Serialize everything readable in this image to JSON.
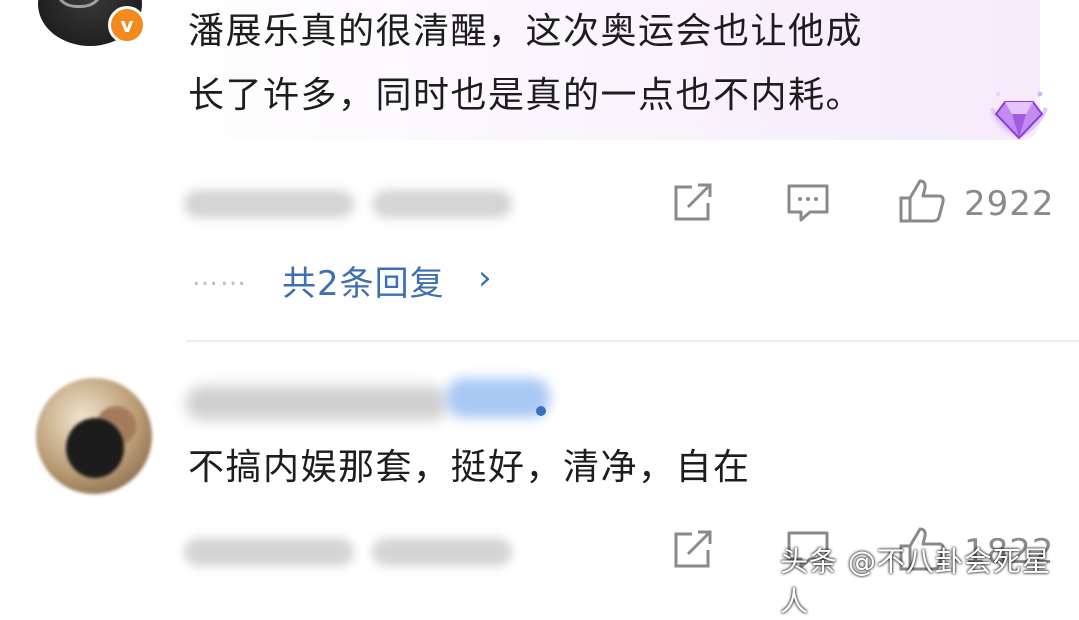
{
  "comments": [
    {
      "verified_badge": "v",
      "text_line1": "潘展乐真的很清醒，这次奥运会也让他成",
      "text_line2": "长了许多，同时也是真的一点也不内耗。",
      "like_count": "2922",
      "reply_dots": "……",
      "reply_link": "共2条回复",
      "reply_chevron": "›",
      "icons": [
        "share-icon",
        "comment-icon",
        "like-icon",
        "diamond-badge-icon"
      ]
    },
    {
      "text": "不搞内娱那套，挺好，清净，自在",
      "like_count": "1822",
      "icons": [
        "share-icon",
        "comment-icon",
        "like-icon"
      ]
    }
  ],
  "watermark": "头条 @不八卦会死星人",
  "colors": {
    "reply_link": "#3e6fb2",
    "verified_badge": "#f28a1e",
    "gem": "#b36ae6"
  }
}
